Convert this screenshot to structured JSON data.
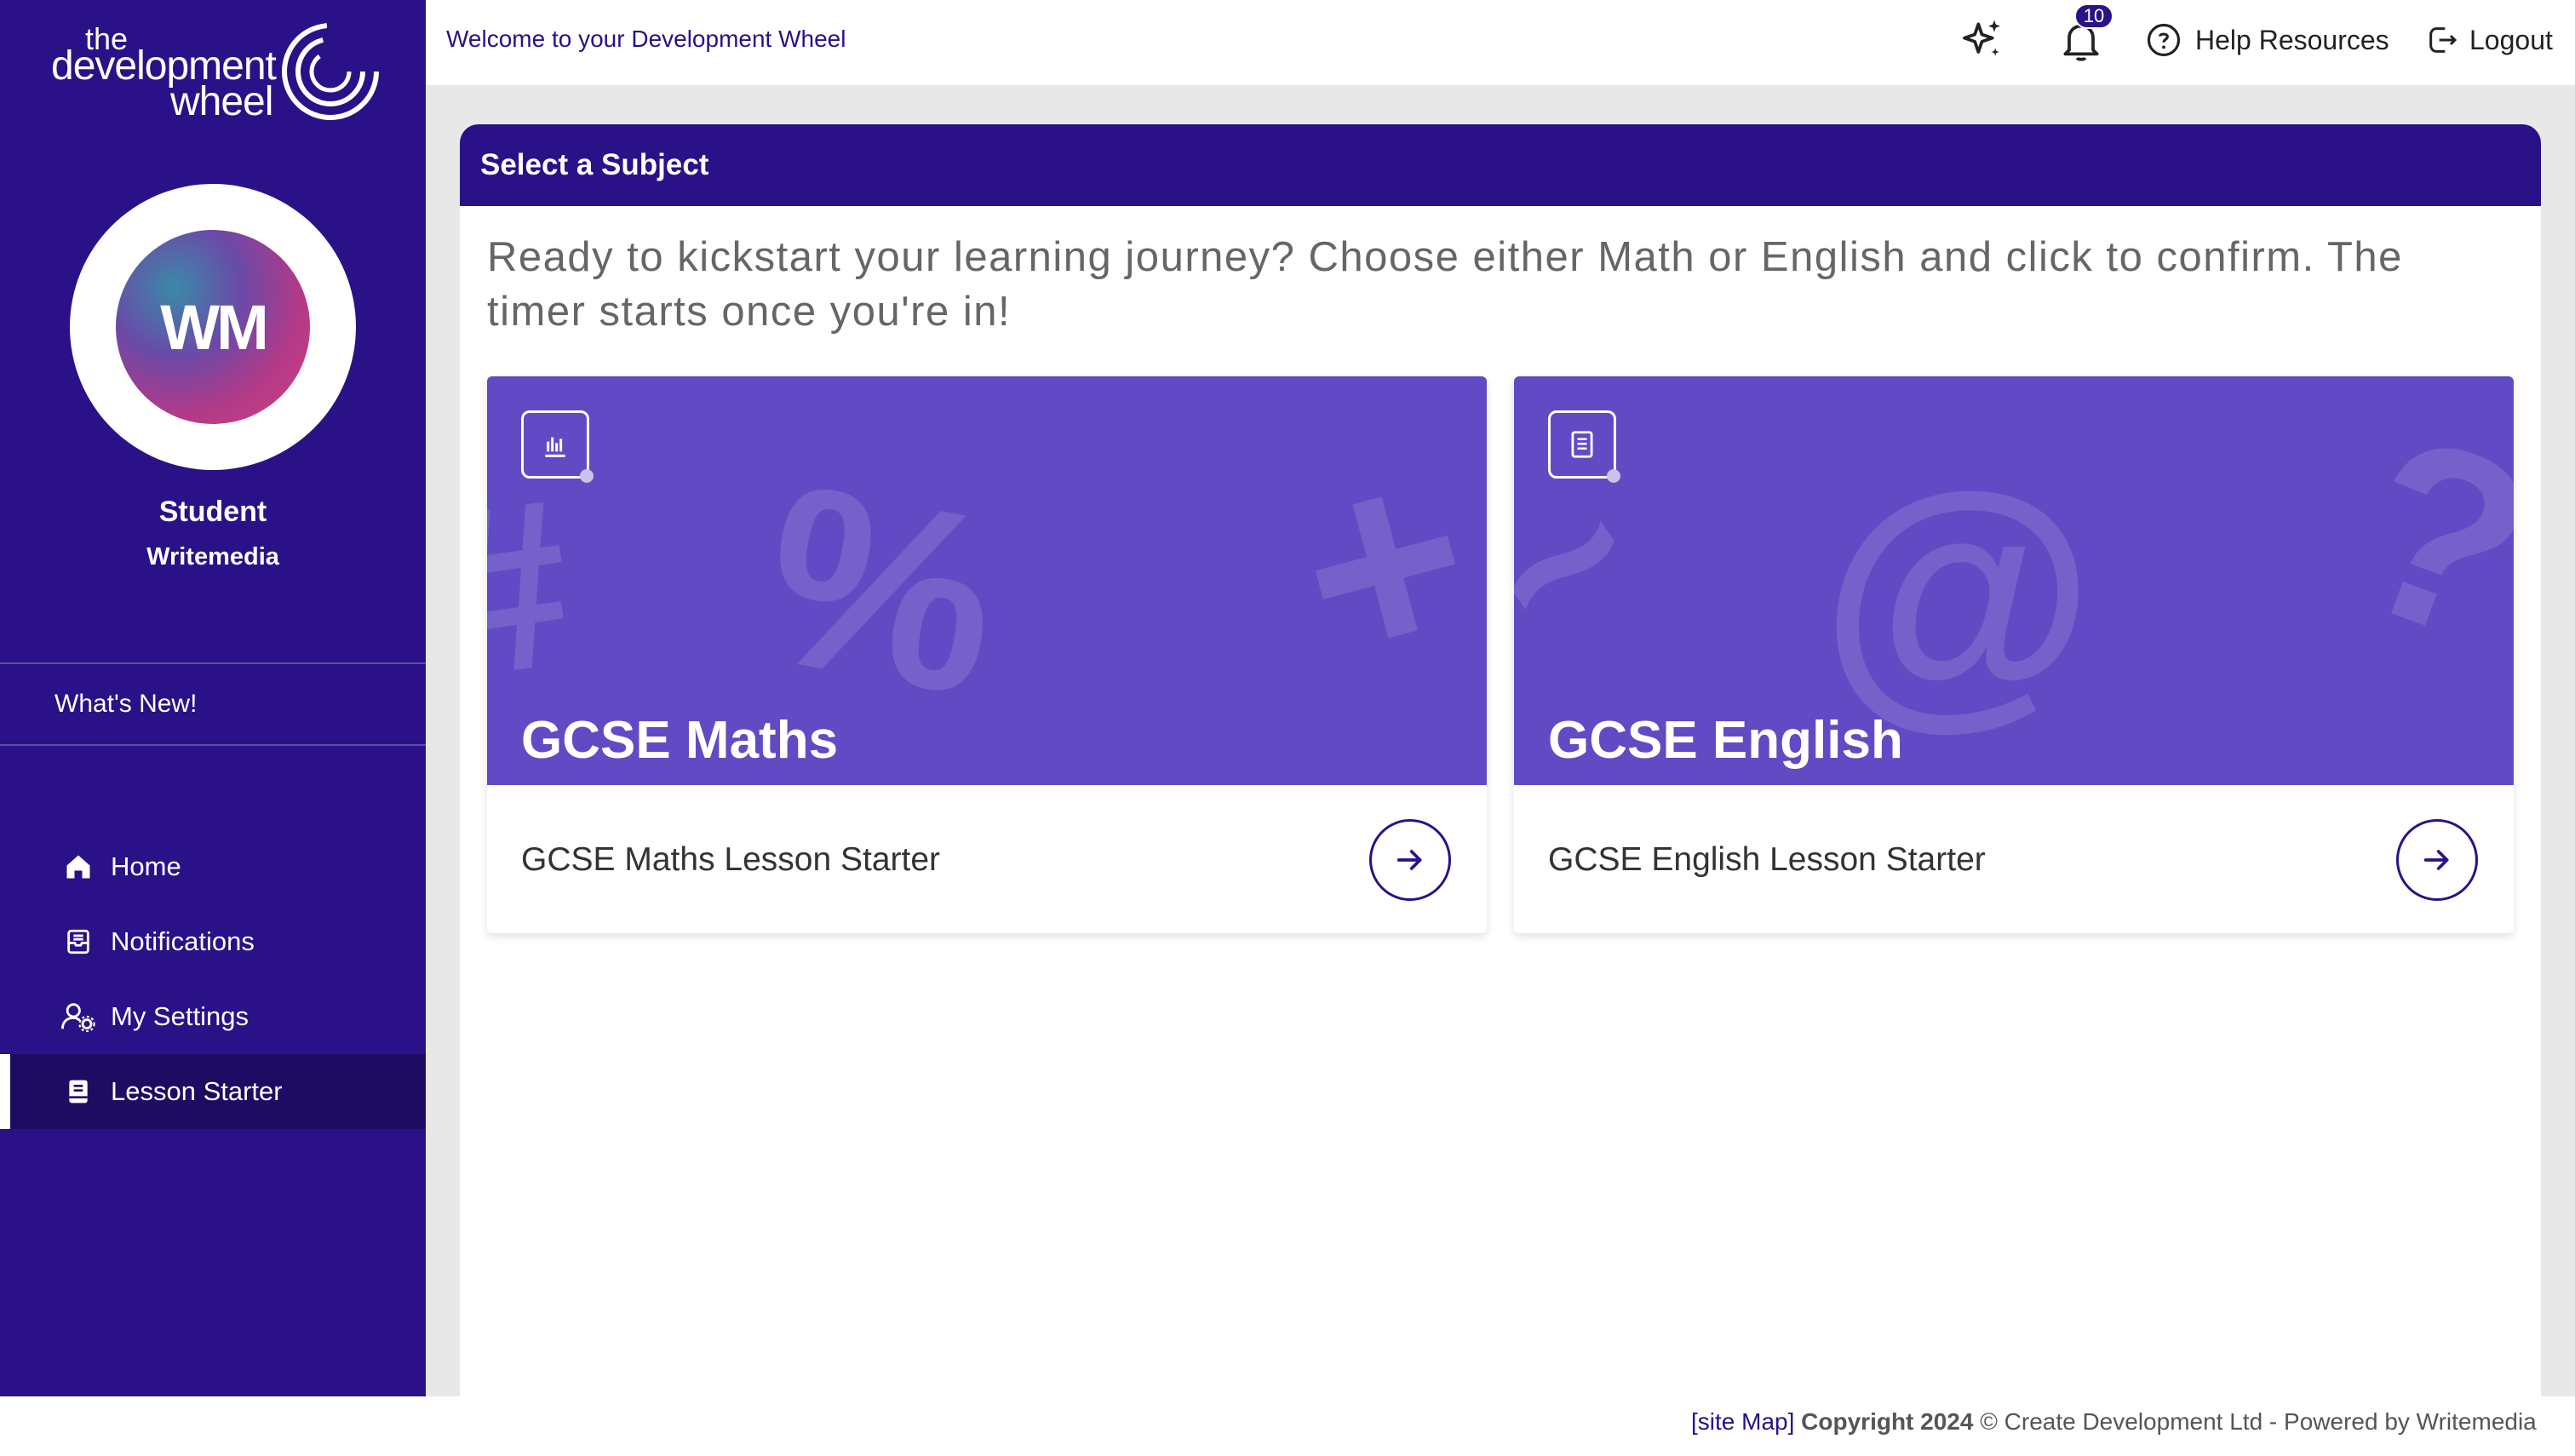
{
  "brand": {
    "logo_line1": "the",
    "logo_line2": "development",
    "logo_line3": "wheel"
  },
  "user": {
    "initials": "WM",
    "name": "Student",
    "org": "Writemedia"
  },
  "sidebar": {
    "whats_new": "What's New!",
    "items": [
      {
        "label": "Home",
        "icon": "home-icon"
      },
      {
        "label": "Notifications",
        "icon": "notifications-icon"
      },
      {
        "label": "My Settings",
        "icon": "user-settings-icon"
      },
      {
        "label": "Lesson Starter",
        "icon": "book-icon",
        "active": true
      }
    ]
  },
  "topbar": {
    "welcome": "Welcome to your Development Wheel",
    "notification_count": "10",
    "help": "Help Resources",
    "logout": "Logout"
  },
  "main": {
    "header": "Select a Subject",
    "intro": "Ready to kickstart your learning journey? Choose either Math or English and click to confirm. The timer starts once you're in!",
    "cards": [
      {
        "title": "GCSE Maths",
        "subtitle": "GCSE Maths Lesson Starter",
        "icon": "chart-icon"
      },
      {
        "title": "GCSE English",
        "subtitle": "GCSE English Lesson Starter",
        "icon": "document-icon"
      }
    ]
  },
  "footer": {
    "site_map": "[site Map]",
    "copyright": "Copyright 2024",
    "rest": "© Create Development Ltd - Powered by Writemedia"
  },
  "colors": {
    "primary": "#2a1188",
    "card": "#624ac4",
    "active_nav": "#1e0c63"
  }
}
